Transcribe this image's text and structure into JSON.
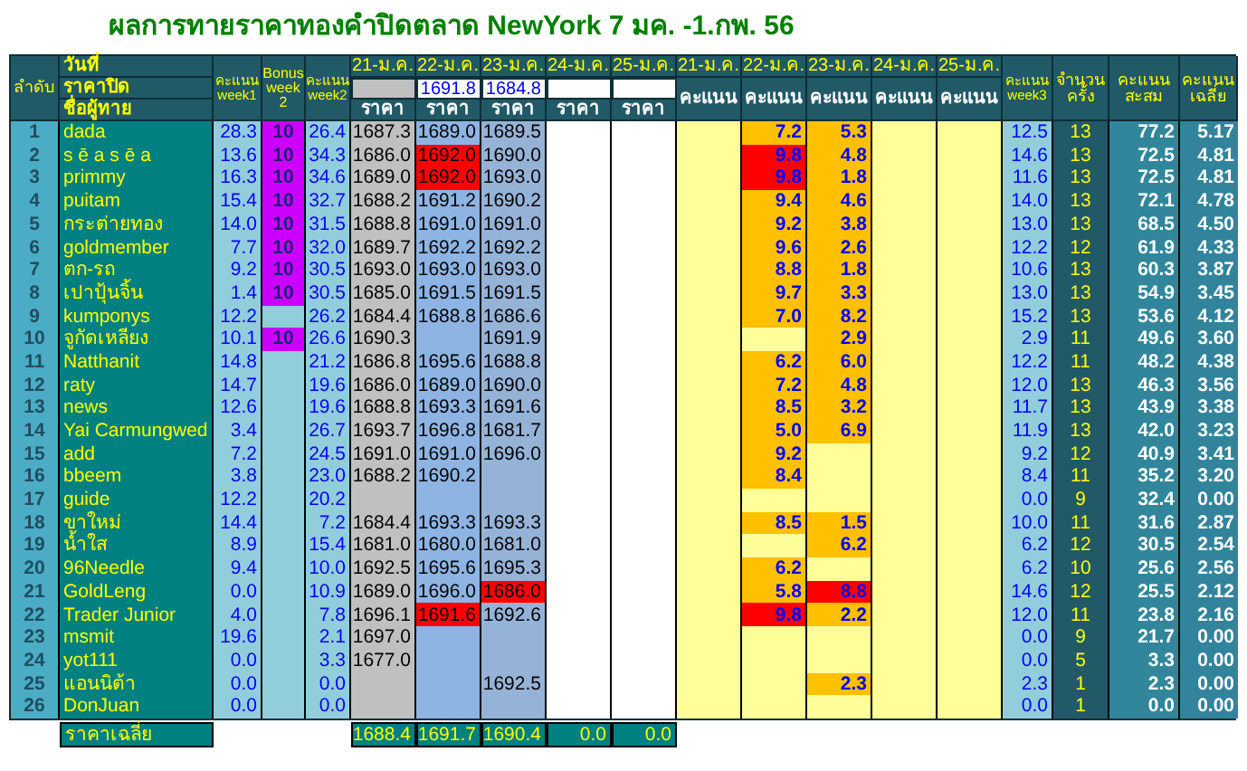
{
  "title": "ผลการทายราคาทองคำปิดตลาด NewYork 7 มค. -1.กพ. 56",
  "header": {
    "rank": "ลำดับ",
    "date_label": "วันที่",
    "close_label": "ราคาปิด",
    "name_label": "ชื่อผู้ทาย",
    "week1": "คะแนน week1",
    "bonus": "Bonus week 2",
    "week2": "คะแนน week2",
    "price_dates": [
      "21-ม.ค.",
      "22-ม.ค.",
      "23-ม.ค.",
      "24-ม.ค.",
      "25-ม.ค."
    ],
    "closing_prices": {
      "d22": "1691.8",
      "d23": "1684.8"
    },
    "price_labels": [
      "ราคา",
      "ราคา",
      "ราคา",
      "ราคา",
      "ราคา"
    ],
    "score_dates": [
      "21-ม.ค.",
      "22-ม.ค.",
      "23-ม.ค.",
      "24-ม.ค.",
      "25-ม.ค."
    ],
    "score_labels": [
      "คะแนน",
      "คะแนน",
      "คะแนน",
      "คะแนน",
      "คะแนน"
    ],
    "week3": "คะแนน week3",
    "count": "จำนวนครั้ง",
    "total": "คะแนนสะสม",
    "average": "คะแนนเฉลี่ย"
  },
  "rows": [
    {
      "rank": "1",
      "name": "dada",
      "week1": "28.3",
      "bonus": "10",
      "week2": "26.4",
      "prices": {
        "d21": {
          "value": "1687.3",
          "flagged": false
        },
        "d22": {
          "value": "1689.0",
          "flagged": false
        },
        "d23": {
          "value": "1689.5",
          "flagged": false
        }
      },
      "scores": {
        "d22": {
          "value": "7.2",
          "flagged": false
        },
        "d23": {
          "value": "5.3",
          "flagged": false
        }
      },
      "week3": "12.5",
      "count": "13",
      "total": "77.2",
      "average": "5.17"
    },
    {
      "rank": "2",
      "name": "s ē a s ē a",
      "week1": "13.6",
      "bonus": "10",
      "week2": "34.3",
      "prices": {
        "d21": {
          "value": "1686.0",
          "flagged": false
        },
        "d22": {
          "value": "1692.0",
          "flagged": true
        },
        "d23": {
          "value": "1690.0",
          "flagged": false
        }
      },
      "scores": {
        "d22": {
          "value": "9.8",
          "flagged": true
        },
        "d23": {
          "value": "4.8",
          "flagged": false
        }
      },
      "week3": "14.6",
      "count": "13",
      "total": "72.5",
      "average": "4.81"
    },
    {
      "rank": "3",
      "name": "primmy",
      "week1": "16.3",
      "bonus": "10",
      "week2": "34.6",
      "prices": {
        "d21": {
          "value": "1689.0",
          "flagged": false
        },
        "d22": {
          "value": "1692.0",
          "flagged": true
        },
        "d23": {
          "value": "1693.0",
          "flagged": false
        }
      },
      "scores": {
        "d22": {
          "value": "9.8",
          "flagged": true
        },
        "d23": {
          "value": "1.8",
          "flagged": false
        }
      },
      "week3": "11.6",
      "count": "13",
      "total": "72.5",
      "average": "4.81"
    },
    {
      "rank": "4",
      "name": "puitam",
      "week1": "15.4",
      "bonus": "10",
      "week2": "32.7",
      "prices": {
        "d21": {
          "value": "1688.2",
          "flagged": false
        },
        "d22": {
          "value": "1691.2",
          "flagged": false
        },
        "d23": {
          "value": "1690.2",
          "flagged": false
        }
      },
      "scores": {
        "d22": {
          "value": "9.4",
          "flagged": false
        },
        "d23": {
          "value": "4.6",
          "flagged": false
        }
      },
      "week3": "14.0",
      "count": "13",
      "total": "72.1",
      "average": "4.78"
    },
    {
      "rank": "5",
      "name": "กระต่ายทอง",
      "week1": "14.0",
      "bonus": "10",
      "week2": "31.5",
      "prices": {
        "d21": {
          "value": "1688.8",
          "flagged": false
        },
        "d22": {
          "value": "1691.0",
          "flagged": false
        },
        "d23": {
          "value": "1691.0",
          "flagged": false
        }
      },
      "scores": {
        "d22": {
          "value": "9.2",
          "flagged": false
        },
        "d23": {
          "value": "3.8",
          "flagged": false
        }
      },
      "week3": "13.0",
      "count": "13",
      "total": "68.5",
      "average": "4.50"
    },
    {
      "rank": "6",
      "name": "goldmember",
      "week1": "7.7",
      "bonus": "10",
      "week2": "32.0",
      "prices": {
        "d21": {
          "value": "1689.7",
          "flagged": false
        },
        "d22": {
          "value": "1692.2",
          "flagged": false
        },
        "d23": {
          "value": "1692.2",
          "flagged": false
        }
      },
      "scores": {
        "d22": {
          "value": "9.6",
          "flagged": false
        },
        "d23": {
          "value": "2.6",
          "flagged": false
        }
      },
      "week3": "12.2",
      "count": "12",
      "total": "61.9",
      "average": "4.33"
    },
    {
      "rank": "7",
      "name": "ตก-รถ",
      "week1": "9.2",
      "bonus": "10",
      "week2": "30.5",
      "prices": {
        "d21": {
          "value": "1693.0",
          "flagged": false
        },
        "d22": {
          "value": "1693.0",
          "flagged": false
        },
        "d23": {
          "value": "1693.0",
          "flagged": false
        }
      },
      "scores": {
        "d22": {
          "value": "8.8",
          "flagged": false
        },
        "d23": {
          "value": "1.8",
          "flagged": false
        }
      },
      "week3": "10.6",
      "count": "13",
      "total": "60.3",
      "average": "3.87"
    },
    {
      "rank": "8",
      "name": "เปาปุ้นจิ้น",
      "week1": "1.4",
      "bonus": "10",
      "week2": "30.5",
      "prices": {
        "d21": {
          "value": "1685.0",
          "flagged": false
        },
        "d22": {
          "value": "1691.5",
          "flagged": false
        },
        "d23": {
          "value": "1691.5",
          "flagged": false
        }
      },
      "scores": {
        "d22": {
          "value": "9.7",
          "flagged": false
        },
        "d23": {
          "value": "3.3",
          "flagged": false
        }
      },
      "week3": "13.0",
      "count": "13",
      "total": "54.9",
      "average": "3.45"
    },
    {
      "rank": "9",
      "name": "kumponys",
      "week1": "12.2",
      "week2": "26.2",
      "prices": {
        "d21": {
          "value": "1684.4",
          "flagged": false
        },
        "d22": {
          "value": "1688.8",
          "flagged": false
        },
        "d23": {
          "value": "1686.6",
          "flagged": false
        }
      },
      "scores": {
        "d22": {
          "value": "7.0",
          "flagged": false
        },
        "d23": {
          "value": "8.2",
          "flagged": false
        }
      },
      "week3": "15.2",
      "count": "13",
      "total": "53.6",
      "average": "4.12"
    },
    {
      "rank": "10",
      "name": "จูกัดเหลียง",
      "week1": "10.1",
      "bonus": "10",
      "week2": "26.6",
      "prices": {
        "d21": {
          "value": "1690.3",
          "flagged": false
        },
        "d23": {
          "value": "1691.9",
          "flagged": false
        }
      },
      "scores": {
        "d23": {
          "value": "2.9",
          "flagged": false
        }
      },
      "week3": "2.9",
      "count": "11",
      "total": "49.6",
      "average": "3.60"
    },
    {
      "rank": "11",
      "name": "Natthanit",
      "week1": "14.8",
      "week2": "21.2",
      "prices": {
        "d21": {
          "value": "1686.8",
          "flagged": false
        },
        "d22": {
          "value": "1695.6",
          "flagged": false
        },
        "d23": {
          "value": "1688.8",
          "flagged": false
        }
      },
      "scores": {
        "d22": {
          "value": "6.2",
          "flagged": false
        },
        "d23": {
          "value": "6.0",
          "flagged": false
        }
      },
      "week3": "12.2",
      "count": "11",
      "total": "48.2",
      "average": "4.38"
    },
    {
      "rank": "12",
      "name": "raty",
      "week1": "14.7",
      "week2": "19.6",
      "prices": {
        "d21": {
          "value": "1686.0",
          "flagged": false
        },
        "d22": {
          "value": "1689.0",
          "flagged": false
        },
        "d23": {
          "value": "1690.0",
          "flagged": false
        }
      },
      "scores": {
        "d22": {
          "value": "7.2",
          "flagged": false
        },
        "d23": {
          "value": "4.8",
          "flagged": false
        }
      },
      "week3": "12.0",
      "count": "13",
      "total": "46.3",
      "average": "3.56"
    },
    {
      "rank": "13",
      "name": "news",
      "week1": "12.6",
      "week2": "19.6",
      "prices": {
        "d21": {
          "value": "1688.8",
          "flagged": false
        },
        "d22": {
          "value": "1693.3",
          "flagged": false
        },
        "d23": {
          "value": "1691.6",
          "flagged": false
        }
      },
      "scores": {
        "d22": {
          "value": "8.5",
          "flagged": false
        },
        "d23": {
          "value": "3.2",
          "flagged": false
        }
      },
      "week3": "11.7",
      "count": "13",
      "total": "43.9",
      "average": "3.38"
    },
    {
      "rank": "14",
      "name": "Yai Carmungwed",
      "week1": "3.4",
      "week2": "26.7",
      "prices": {
        "d21": {
          "value": "1693.7",
          "flagged": false
        },
        "d22": {
          "value": "1696.8",
          "flagged": false
        },
        "d23": {
          "value": "1681.7",
          "flagged": false
        }
      },
      "scores": {
        "d22": {
          "value": "5.0",
          "flagged": false
        },
        "d23": {
          "value": "6.9",
          "flagged": false
        }
      },
      "week3": "11.9",
      "count": "13",
      "total": "42.0",
      "average": "3.23"
    },
    {
      "rank": "15",
      "name": "add",
      "week1": "7.2",
      "week2": "24.5",
      "prices": {
        "d21": {
          "value": "1691.0",
          "flagged": false
        },
        "d22": {
          "value": "1691.0",
          "flagged": false
        },
        "d23": {
          "value": "1696.0",
          "flagged": false
        }
      },
      "scores": {
        "d22": {
          "value": "9.2",
          "flagged": false
        }
      },
      "week3": "9.2",
      "count": "12",
      "total": "40.9",
      "average": "3.41"
    },
    {
      "rank": "16",
      "name": "bbeem",
      "week1": "3.8",
      "week2": "23.0",
      "prices": {
        "d21": {
          "value": "1688.2",
          "flagged": false
        },
        "d22": {
          "value": "1690.2",
          "flagged": false
        }
      },
      "scores": {
        "d22": {
          "value": "8.4",
          "flagged": false
        }
      },
      "week3": "8.4",
      "count": "11",
      "total": "35.2",
      "average": "3.20"
    },
    {
      "rank": "17",
      "name": "guide",
      "week1": "12.2",
      "week2": "20.2",
      "week3": "0.0",
      "count": "9",
      "total": "32.4",
      "average": "0.00"
    },
    {
      "rank": "18",
      "name": "ขาใหม่",
      "week1": "14.4",
      "week2": "7.2",
      "prices": {
        "d21": {
          "value": "1684.4",
          "flagged": false
        },
        "d22": {
          "value": "1693.3",
          "flagged": false
        },
        "d23": {
          "value": "1693.3",
          "flagged": false
        }
      },
      "scores": {
        "d22": {
          "value": "8.5",
          "flagged": false
        },
        "d23": {
          "value": "1.5",
          "flagged": false
        }
      },
      "week3": "10.0",
      "count": "11",
      "total": "31.6",
      "average": "2.87"
    },
    {
      "rank": "19",
      "name": "น้ำใส",
      "week1": "8.9",
      "week2": "15.4",
      "prices": {
        "d21": {
          "value": "1681.0",
          "flagged": false
        },
        "d22": {
          "value": "1680.0",
          "flagged": false
        },
        "d23": {
          "value": "1681.0",
          "flagged": false
        }
      },
      "scores": {
        "d23": {
          "value": "6.2",
          "flagged": false
        }
      },
      "week3": "6.2",
      "count": "12",
      "total": "30.5",
      "average": "2.54"
    },
    {
      "rank": "20",
      "name": "96Needle",
      "week1": "9.4",
      "week2": "10.0",
      "prices": {
        "d21": {
          "value": "1692.5",
          "flagged": false
        },
        "d22": {
          "value": "1695.6",
          "flagged": false
        },
        "d23": {
          "value": "1695.3",
          "flagged": false
        }
      },
      "scores": {
        "d22": {
          "value": "6.2",
          "flagged": false
        }
      },
      "week3": "6.2",
      "count": "10",
      "total": "25.6",
      "average": "2.56"
    },
    {
      "rank": "21",
      "name": "GoldLeng",
      "week1": "0.0",
      "week2": "10.9",
      "prices": {
        "d21": {
          "value": "1689.0",
          "flagged": false
        },
        "d22": {
          "value": "1696.0",
          "flagged": false
        },
        "d23": {
          "value": "1686.0",
          "flagged": true
        }
      },
      "scores": {
        "d22": {
          "value": "5.8",
          "flagged": false
        },
        "d23": {
          "value": "8.8",
          "flagged": true
        }
      },
      "week3": "14.6",
      "count": "12",
      "total": "25.5",
      "average": "2.12"
    },
    {
      "rank": "22",
      "name": "Trader Junior",
      "week1": "4.0",
      "week2": "7.8",
      "prices": {
        "d21": {
          "value": "1696.1",
          "flagged": false
        },
        "d22": {
          "value": "1691.6",
          "flagged": true
        },
        "d23": {
          "value": "1692.6",
          "flagged": false
        }
      },
      "scores": {
        "d22": {
          "value": "9.8",
          "flagged": true
        },
        "d23": {
          "value": "2.2",
          "flagged": false
        }
      },
      "week3": "12.0",
      "count": "11",
      "total": "23.8",
      "average": "2.16"
    },
    {
      "rank": "23",
      "name": "msmit",
      "week1": "19.6",
      "week2": "2.1",
      "prices": {
        "d21": {
          "value": "1697.0",
          "flagged": false
        }
      },
      "week3": "0.0",
      "count": "9",
      "total": "21.7",
      "average": "0.00"
    },
    {
      "rank": "24",
      "name": "yot111",
      "week1": "0.0",
      "week2": "3.3",
      "prices": {
        "d21": {
          "value": "1677.0",
          "flagged": false
        }
      },
      "week3": "0.0",
      "count": "5",
      "total": "3.3",
      "average": "0.00"
    },
    {
      "rank": "25",
      "name": "แอนนิต้า",
      "week1": "0.0",
      "week2": "0.0",
      "prices": {
        "d23": {
          "value": "1692.5",
          "flagged": false
        }
      },
      "scores": {
        "d23": {
          "value": "2.3",
          "flagged": false
        }
      },
      "week3": "2.3",
      "count": "1",
      "total": "2.3",
      "average": "0.00"
    },
    {
      "rank": "26",
      "name": "DonJuan",
      "week1": "0.0",
      "week2": "0.0",
      "week3": "0.0",
      "count": "1",
      "total": "0.0",
      "average": "0.00"
    }
  ],
  "averages": {
    "label": "ราคาเฉลี่ย",
    "values": [
      "1688.4",
      "1691.7",
      "1690.4",
      "0.0",
      "0.0"
    ]
  }
}
